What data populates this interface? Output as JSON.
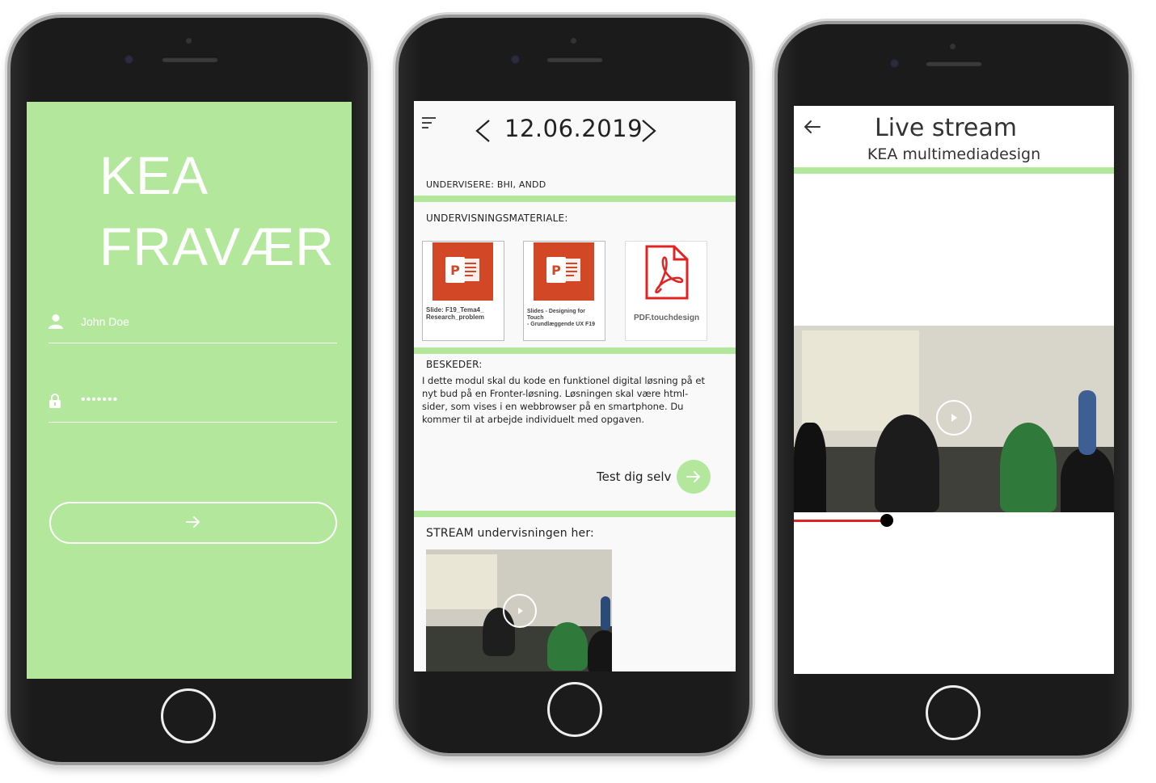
{
  "login_screen": {
    "title_line1": "KEA",
    "title_line2": "FRAVÆR",
    "username_value": "John Doe",
    "password_value": "•••••••",
    "username_icon": "user-icon",
    "password_icon": "lock-icon",
    "submit_icon": "arrow-right-icon",
    "colors": {
      "background": "#b3e89c",
      "foreground": "#ffffff"
    }
  },
  "lesson_screen": {
    "menu_icon": "hamburger-menu-icon",
    "date": "12.06.2019",
    "prev_icon": "chevron-left-icon",
    "next_icon": "chevron-right-icon",
    "teachers_label": "UNDERVISERE: BHI, ANDD",
    "materials_label": "UNDERVISNINGSMATERIALE:",
    "materials": [
      {
        "caption_line1": "Slide: F19_Tema4_",
        "caption_line2": "Research_problem",
        "caption_line3": "",
        "icon": "powerpoint-icon"
      },
      {
        "caption_line1": "Slides - Designing for",
        "caption_line2": "Touch",
        "caption_line3": "- Grundlæggende UX F19",
        "icon": "powerpoint-icon"
      },
      {
        "caption_line1": "PDF.touchdesign",
        "caption_line2": "",
        "caption_line3": "",
        "icon": "pdf-icon"
      }
    ],
    "messages_label": "BESKEDER:",
    "message_text": "I dette modul skal du kode en funktionel digital løsning på et nyt bud på en Fronter-løsning. Løsningen skal være html-sider, som vises i en webbrowser på en smartphone. Du kommer til at arbejde individuelt med opgaven.",
    "test_label": "Test dig selv",
    "test_icon": "arrow-right-icon",
    "stream_label": "STREAM undervisningen her:",
    "play_icon": "play-icon",
    "colors": {
      "accent": "#b3e89c"
    }
  },
  "stream_screen": {
    "back_icon": "arrow-left-icon",
    "title": "Live stream",
    "subtitle": "KEA multimediadesign",
    "play_icon": "play-icon",
    "progress": 0.29,
    "colors": {
      "accent": "#b3e89c",
      "progress": "#e02424"
    }
  }
}
